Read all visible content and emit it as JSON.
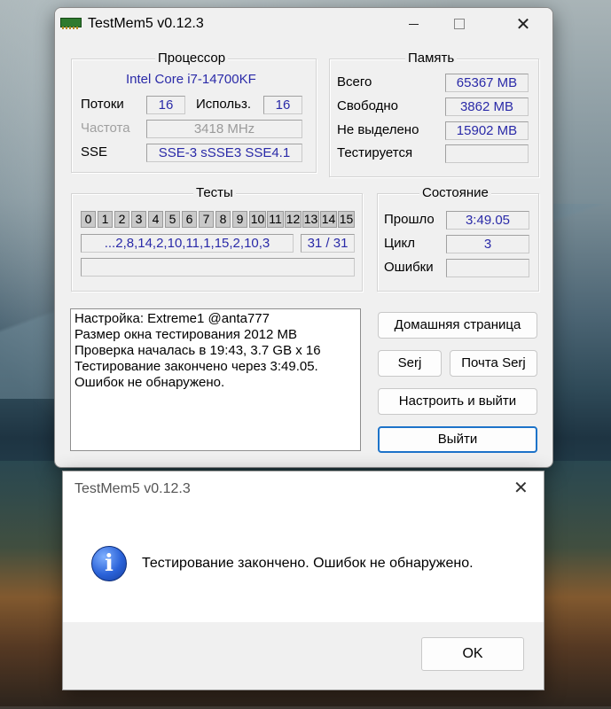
{
  "window": {
    "title": "TestMem5 v0.12.3"
  },
  "processor": {
    "group_title": "Процессор",
    "name": "Intel Core i7-14700KF",
    "threads_label": "Потоки",
    "threads_value": "16",
    "used_label": "Использ.",
    "used_value": "16",
    "freq_label": "Частота",
    "freq_value": "3418 MHz",
    "sse_label": "SSE",
    "sse_value": "SSE-3 sSSE3 SSE4.1"
  },
  "memory": {
    "group_title": "Память",
    "total_label": "Всего",
    "total_value": "65367 MB",
    "free_label": "Свободно",
    "free_value": "3862 MB",
    "unallocated_label": "Не выделено",
    "unallocated_value": "15902 MB",
    "testing_label": "Тестируется",
    "testing_value": ""
  },
  "tests": {
    "group_title": "Тесты",
    "cells": [
      "0",
      "1",
      "2",
      "3",
      "4",
      "5",
      "6",
      "7",
      "8",
      "9",
      "10",
      "11",
      "12",
      "13",
      "14",
      "15"
    ],
    "sequence": "...2,8,14,2,10,11,1,15,2,10,3",
    "progress": "31 / 31",
    "current": ""
  },
  "status": {
    "group_title": "Состояние",
    "elapsed_label": "Прошло",
    "elapsed_value": "3:49.05",
    "cycle_label": "Цикл",
    "cycle_value": "3",
    "errors_label": "Ошибки",
    "errors_value": ""
  },
  "log": {
    "lines": [
      "Настройка: Extreme1 @anta777",
      "Размер окна тестирования 2012 MB",
      "Проверка началась в 19:43, 3.7 GB x 16",
      "Тестирование закончено через 3:49.05.",
      "Ошибок не обнаружено."
    ]
  },
  "buttons": {
    "homepage": "Домашняя страница",
    "serj": "Serj",
    "mail_serj": "Почта Serj",
    "configure_exit": "Настроить и выйти",
    "exit": "Выйти"
  },
  "dialog": {
    "title": "TestMem5 v0.12.3",
    "message": "Тестирование закончено. Ошибок не обнаружено.",
    "ok": "OK"
  }
}
